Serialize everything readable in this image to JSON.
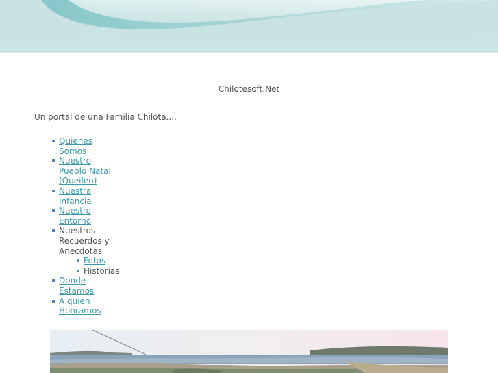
{
  "site": {
    "title": "Chilotesoft.Net",
    "tagline": "Un portal de una Familia Chilota...."
  },
  "nav": {
    "items": [
      {
        "label": "Quienes Somos",
        "link": true
      },
      {
        "label": "Nuestro Pueblo Natal (Queilen)",
        "link": true
      },
      {
        "label": "Nuestra Infancia",
        "link": true
      },
      {
        "label": "Nuestro Entorno",
        "link": true
      },
      {
        "label": "Nuestros Recuerdos y Anecdotas",
        "link": false
      },
      {
        "label": "Donde Estamos",
        "link": true
      },
      {
        "label": "A quien Honramos",
        "link": true
      }
    ],
    "subitems": [
      {
        "label": "Fotos",
        "link": true
      },
      {
        "label": "Historias",
        "link": false
      }
    ]
  },
  "colors": {
    "link": "#3d9aa8",
    "bullet": "#5d86b8",
    "text": "#555555",
    "banner": "#c3dfe0"
  }
}
